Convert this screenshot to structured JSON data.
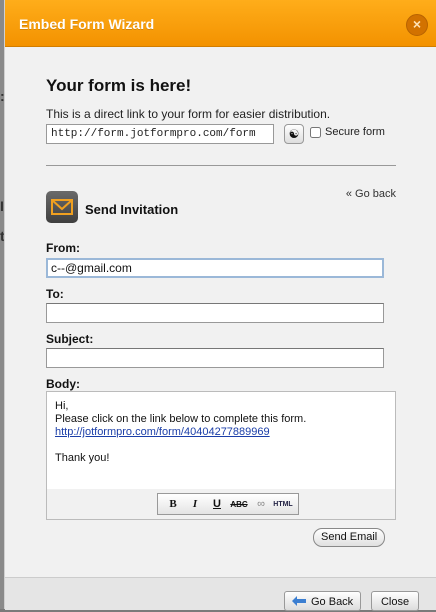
{
  "dialog": {
    "title": "Embed Form Wizard",
    "close_glyph": "×"
  },
  "form_link": {
    "heading": "Your form is here!",
    "description": "This is a direct link to your form for easier distribution.",
    "url": "http://form.jotformpro.com/form",
    "link_button_icon": "link-icon",
    "secure_label": "Secure form",
    "secure_checked": false
  },
  "invitation": {
    "go_back_link": "« Go back",
    "title": "Send Invitation",
    "icon": "envelope-icon",
    "from_label": "From:",
    "from_value": "c--@gmail.com",
    "to_label": "To:",
    "to_value": "",
    "subject_label": "Subject:",
    "subject_value": "",
    "body_label": "Body:",
    "body_greeting": "Hi,",
    "body_instruction": "Please click on the link below to complete this form.",
    "body_link": "http://jotformpro.com/form/40404277889969",
    "body_signoff": "Thank you!",
    "toolbar": {
      "bold": "B",
      "italic": "I",
      "underline": "U",
      "strike": "ABC",
      "link": "∞",
      "html": "HTML"
    },
    "send_email_label": "Send Email"
  },
  "footer": {
    "go_back_label": "Go Back",
    "close_label": "Close"
  },
  "colors": {
    "title_bar": "#f39200",
    "link": "#1b3ea8"
  }
}
